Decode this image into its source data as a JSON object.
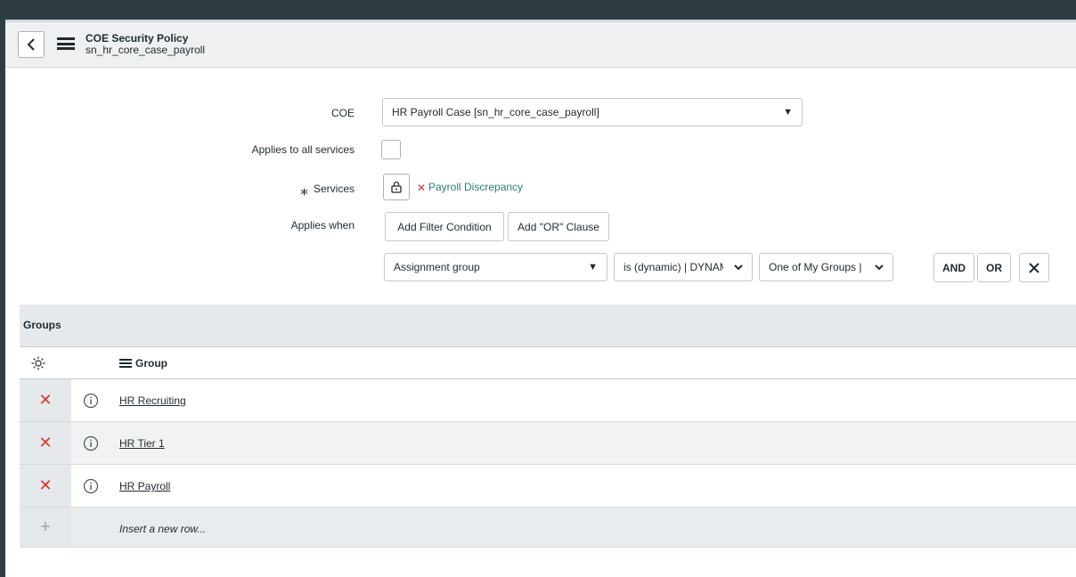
{
  "header": {
    "title": "COE Security Policy",
    "subtitle": "sn_hr_core_case_payroll"
  },
  "form": {
    "coe_label": "COE",
    "coe_value": "HR Payroll Case [sn_hr_core_case_payroll]",
    "applies_all_label": "Applies to all services",
    "services_label": "Services",
    "services_value": "Payroll Discrepancy",
    "applies_when_label": "Applies when",
    "add_filter_label": "Add Filter Condition",
    "add_or_label": "Add \"OR\" Clause",
    "field_value": "Assignment group",
    "operator_value": "is (dynamic) | DYNAM",
    "value_value": "One of My Groups |",
    "and_label": "AND",
    "or_label": "OR"
  },
  "groups": {
    "title": "Groups",
    "column": "Group",
    "rows": [
      "HR Recruiting",
      "HR Tier 1",
      "HR Payroll"
    ],
    "insert_label": "Insert a new row..."
  },
  "colors": {
    "topbar": "#2e3d42",
    "delete": "#d9362b",
    "service_link": "#2e7d72"
  }
}
